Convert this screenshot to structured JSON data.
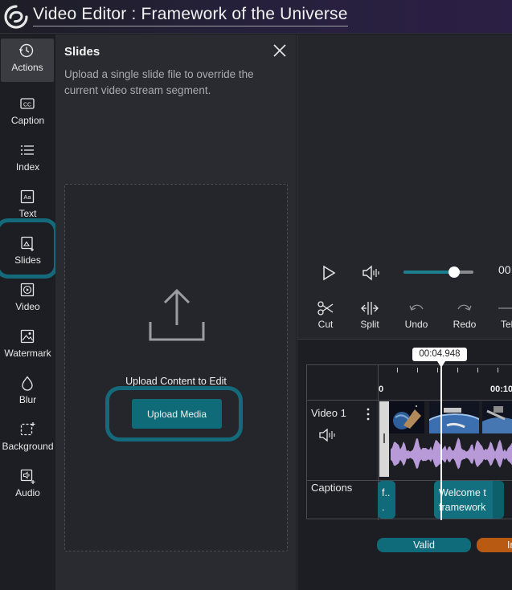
{
  "app": {
    "title": "Video Editor : Framework of the Universe"
  },
  "sidebar": {
    "items": [
      {
        "label": "Actions",
        "icon": "history-icon",
        "active": true
      },
      {
        "label": "Caption",
        "icon": "closed-caption-icon"
      },
      {
        "label": "Index",
        "icon": "list-icon"
      },
      {
        "label": "Text",
        "icon": "text-box-icon"
      },
      {
        "label": "Slides",
        "icon": "slides-icon",
        "highlighted": true
      },
      {
        "label": "Video",
        "icon": "video-play-icon"
      },
      {
        "label": "Watermark",
        "icon": "image-watermark-icon"
      },
      {
        "label": "Blur",
        "icon": "droplet-icon"
      },
      {
        "label": "Background",
        "icon": "background-add-icon"
      },
      {
        "label": "Audio",
        "icon": "audio-add-icon"
      }
    ]
  },
  "panel": {
    "title": "Slides",
    "description": "Upload a single slide file to override the current video stream segment.",
    "upload_caption": "Upload Content to Edit",
    "upload_button": "Upload Media"
  },
  "player": {
    "time": "00",
    "volume_fraction": 0.72
  },
  "tools": [
    {
      "label": "Cut",
      "icon": "scissors-icon"
    },
    {
      "label": "Split",
      "icon": "split-icon"
    },
    {
      "label": "Undo",
      "icon": "undo-icon"
    },
    {
      "label": "Redo",
      "icon": "redo-icon"
    },
    {
      "label": "Tel",
      "icon": "partial-icon"
    }
  ],
  "timeline": {
    "playhead_time": "00:04.948",
    "ruler_start": "0",
    "ruler_mark": "00:10",
    "tracks": {
      "video": "Video 1",
      "captions": "Captions"
    },
    "caption_clips": [
      {
        "text": "f... o..."
      },
      {
        "text": "Welcome t framework"
      }
    ],
    "status": [
      {
        "label": "Valid",
        "color": "#0f6b7a"
      },
      {
        "label": "In",
        "color": "#b85a12"
      }
    ]
  },
  "colors": {
    "accent": "#146a7a",
    "background": "#1d1e24",
    "panel": "#2a2b31",
    "waveform": "#b89ad8"
  }
}
